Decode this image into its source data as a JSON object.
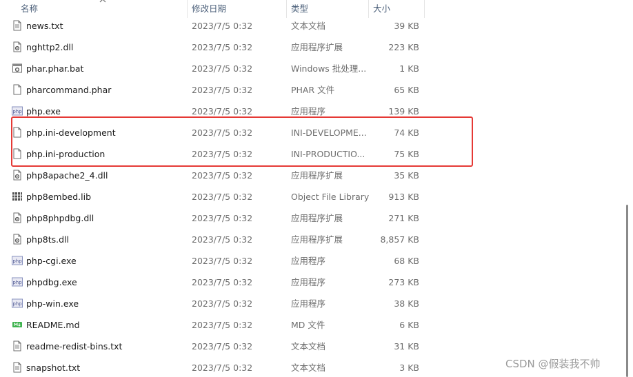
{
  "columns": {
    "name": "名称",
    "date": "修改日期",
    "type": "类型",
    "size": "大小"
  },
  "files": [
    {
      "name": "news.txt",
      "date": "2023/7/5 0:32",
      "type": "文本文档",
      "size": "39 KB",
      "icon": "text-file-icon"
    },
    {
      "name": "nghttp2.dll",
      "date": "2023/7/5 0:32",
      "type": "应用程序扩展",
      "size": "223 KB",
      "icon": "dll-file-icon"
    },
    {
      "name": "phar.phar.bat",
      "date": "2023/7/5 0:32",
      "type": "Windows 批处理...",
      "size": "1 KB",
      "icon": "batch-file-icon"
    },
    {
      "name": "pharcommand.phar",
      "date": "2023/7/5 0:32",
      "type": "PHAR 文件",
      "size": "65 KB",
      "icon": "blank-file-icon"
    },
    {
      "name": "php.exe",
      "date": "2023/7/5 0:32",
      "type": "应用程序",
      "size": "139 KB",
      "icon": "php-exe-icon"
    },
    {
      "name": "php.ini-development",
      "date": "2023/7/5 0:32",
      "type": "INI-DEVELOPME...",
      "size": "74 KB",
      "icon": "blank-file-icon"
    },
    {
      "name": "php.ini-production",
      "date": "2023/7/5 0:32",
      "type": "INI-PRODUCTIO...",
      "size": "75 KB",
      "icon": "blank-file-icon"
    },
    {
      "name": "php8apache2_4.dll",
      "date": "2023/7/5 0:32",
      "type": "应用程序扩展",
      "size": "35 KB",
      "icon": "dll-file-icon"
    },
    {
      "name": "php8embed.lib",
      "date": "2023/7/5 0:32",
      "type": "Object File Library",
      "size": "913 KB",
      "icon": "lib-file-icon"
    },
    {
      "name": "php8phpdbg.dll",
      "date": "2023/7/5 0:32",
      "type": "应用程序扩展",
      "size": "271 KB",
      "icon": "dll-file-icon"
    },
    {
      "name": "php8ts.dll",
      "date": "2023/7/5 0:32",
      "type": "应用程序扩展",
      "size": "8,857 KB",
      "icon": "dll-file-icon"
    },
    {
      "name": "php-cgi.exe",
      "date": "2023/7/5 0:32",
      "type": "应用程序",
      "size": "68 KB",
      "icon": "php-exe-icon"
    },
    {
      "name": "phpdbg.exe",
      "date": "2023/7/5 0:32",
      "type": "应用程序",
      "size": "273 KB",
      "icon": "php-exe-icon"
    },
    {
      "name": "php-win.exe",
      "date": "2023/7/5 0:32",
      "type": "应用程序",
      "size": "38 KB",
      "icon": "php-exe-icon"
    },
    {
      "name": "README.md",
      "date": "2023/7/5 0:32",
      "type": "MD 文件",
      "size": "6 KB",
      "icon": "markdown-file-icon"
    },
    {
      "name": "readme-redist-bins.txt",
      "date": "2023/7/5 0:32",
      "type": "文本文档",
      "size": "31 KB",
      "icon": "text-file-icon"
    },
    {
      "name": "snapshot.txt",
      "date": "2023/7/5 0:32",
      "type": "文本文档",
      "size": "3 KB",
      "icon": "text-file-icon"
    }
  ],
  "watermark": "CSDN @假装我不帅",
  "colors": {
    "highlight": "#e53935",
    "header_text": "#4c607a"
  }
}
